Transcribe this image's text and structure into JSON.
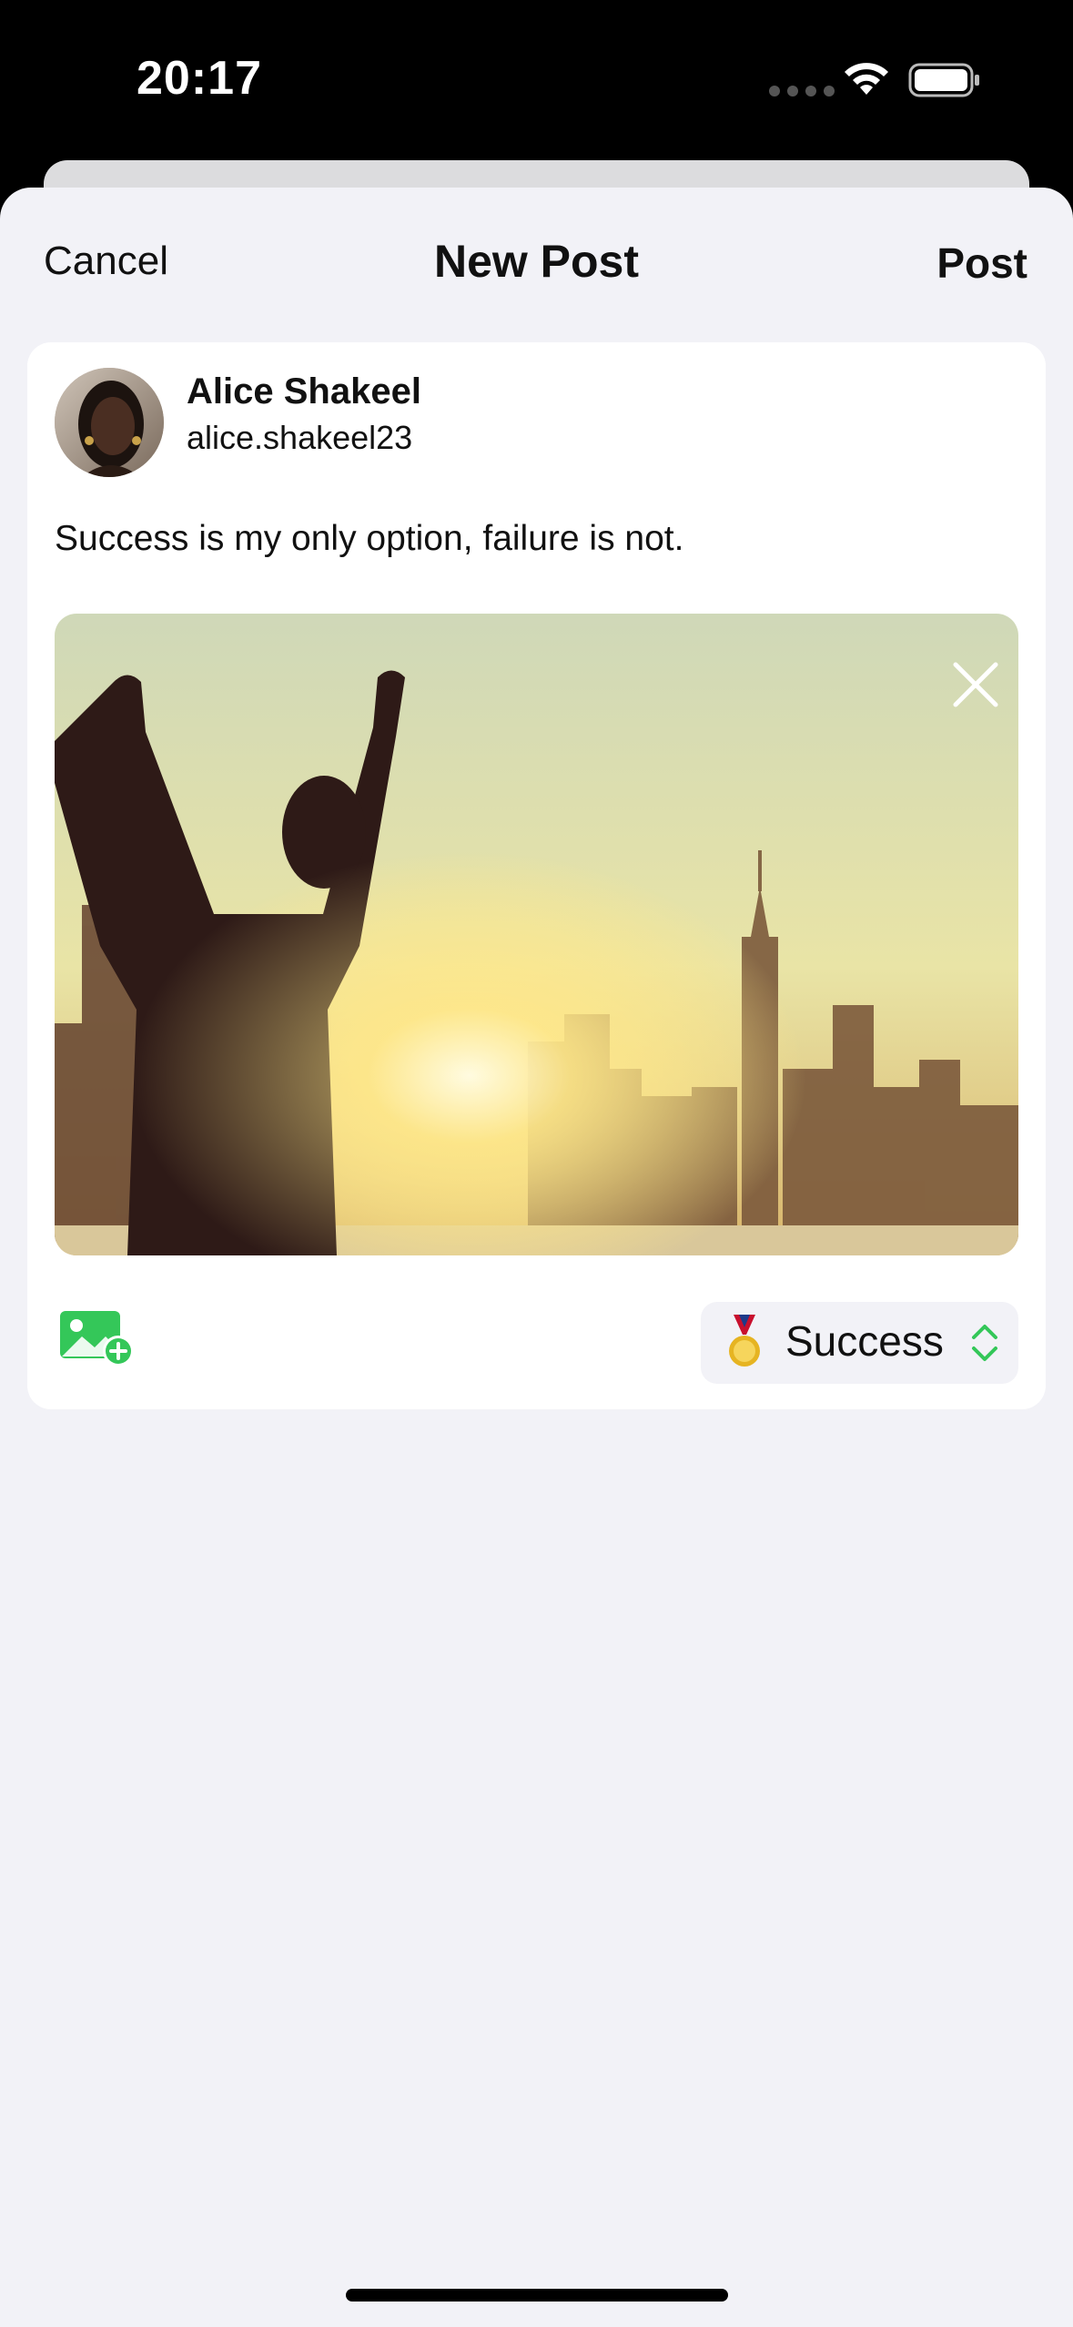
{
  "status_bar": {
    "time": "20:17"
  },
  "nav": {
    "cancel_label": "Cancel",
    "title": "New Post",
    "post_label": "Post"
  },
  "user": {
    "name": "Alice Shakeel",
    "handle": "alice.shakeel23"
  },
  "post": {
    "text": "Success is my only option, failure is not."
  },
  "composer": {
    "add_photo_icon": "photo-badge-plus-icon",
    "category": {
      "emoji": "medal-icon",
      "label": "Success"
    }
  },
  "colors": {
    "accent_green": "#34c759",
    "sheet_bg": "#f2f2f7"
  }
}
